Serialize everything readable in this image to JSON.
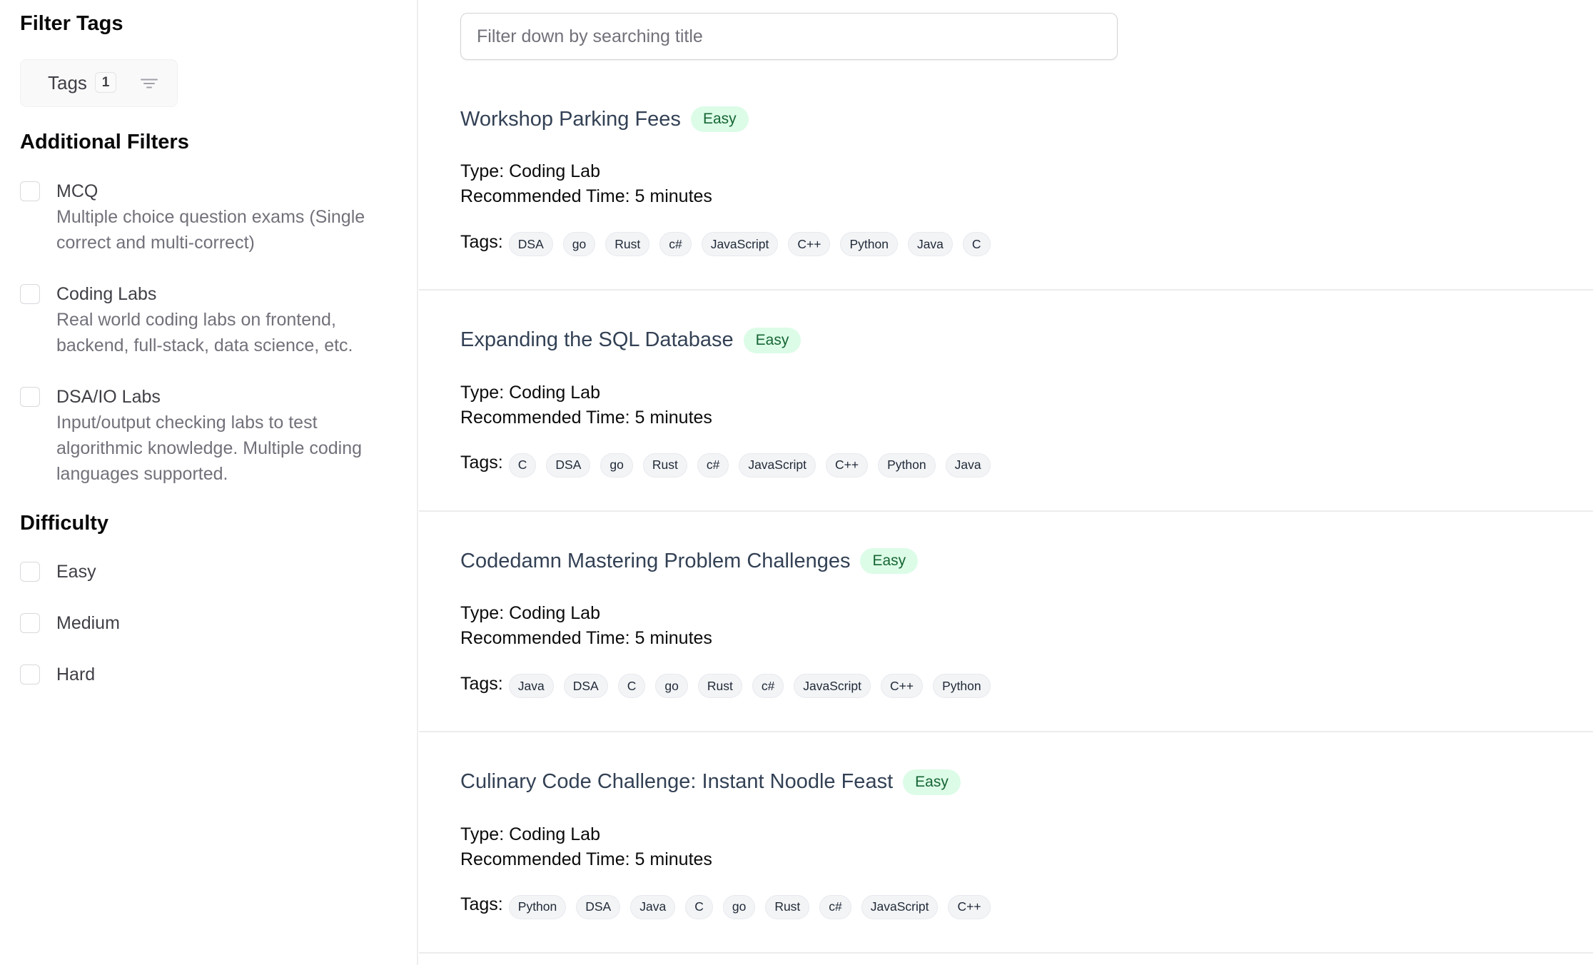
{
  "sidebar": {
    "filter_tags_heading": "Filter Tags",
    "tags_button": {
      "label": "Tags",
      "count": "1",
      "icon": "filter-lines-icon"
    },
    "additional_filters_heading": "Additional Filters",
    "additional_filters": [
      {
        "label": "MCQ",
        "description": "Multiple choice question exams (Single correct and multi-correct)",
        "checked": false
      },
      {
        "label": "Coding Labs",
        "description": "Real world coding labs on frontend, backend, full-stack, data science, etc.",
        "checked": false
      },
      {
        "label": "DSA/IO Labs",
        "description": "Input/output checking labs to test algorithmic knowledge. Multiple coding languages supported.",
        "checked": false
      }
    ],
    "difficulty_heading": "Difficulty",
    "difficulty_options": [
      {
        "label": "Easy",
        "checked": false
      },
      {
        "label": "Medium",
        "checked": false
      },
      {
        "label": "Hard",
        "checked": false
      }
    ]
  },
  "search": {
    "placeholder": "Filter down by searching title",
    "value": ""
  },
  "labels": {
    "tags_prefix": "Tags:"
  },
  "colors": {
    "easy_badge_bg": "#dcfce7",
    "easy_badge_text": "#166534",
    "title_text": "#334155",
    "pill_bg": "#f3f4f6"
  },
  "cards": [
    {
      "title": "Workshop Parking Fees",
      "difficulty": "Easy",
      "type": "Type: Coding Lab",
      "recommended_time": "Recommended Time: 5 minutes",
      "tags": [
        "DSA",
        "go",
        "Rust",
        "c#",
        "JavaScript",
        "C++",
        "Python",
        "Java",
        "C"
      ]
    },
    {
      "title": "Expanding the SQL Database",
      "difficulty": "Easy",
      "type": "Type: Coding Lab",
      "recommended_time": "Recommended Time: 5 minutes",
      "tags": [
        "C",
        "DSA",
        "go",
        "Rust",
        "c#",
        "JavaScript",
        "C++",
        "Python",
        "Java"
      ]
    },
    {
      "title": "Codedamn Mastering Problem Challenges",
      "difficulty": "Easy",
      "type": "Type: Coding Lab",
      "recommended_time": "Recommended Time: 5 minutes",
      "tags": [
        "Java",
        "DSA",
        "C",
        "go",
        "Rust",
        "c#",
        "JavaScript",
        "C++",
        "Python"
      ]
    },
    {
      "title": "Culinary Code Challenge: Instant Noodle Feast",
      "difficulty": "Easy",
      "type": "Type: Coding Lab",
      "recommended_time": "Recommended Time: 5 minutes",
      "tags": [
        "Python",
        "DSA",
        "Java",
        "C",
        "go",
        "Rust",
        "c#",
        "JavaScript",
        "C++"
      ]
    }
  ]
}
